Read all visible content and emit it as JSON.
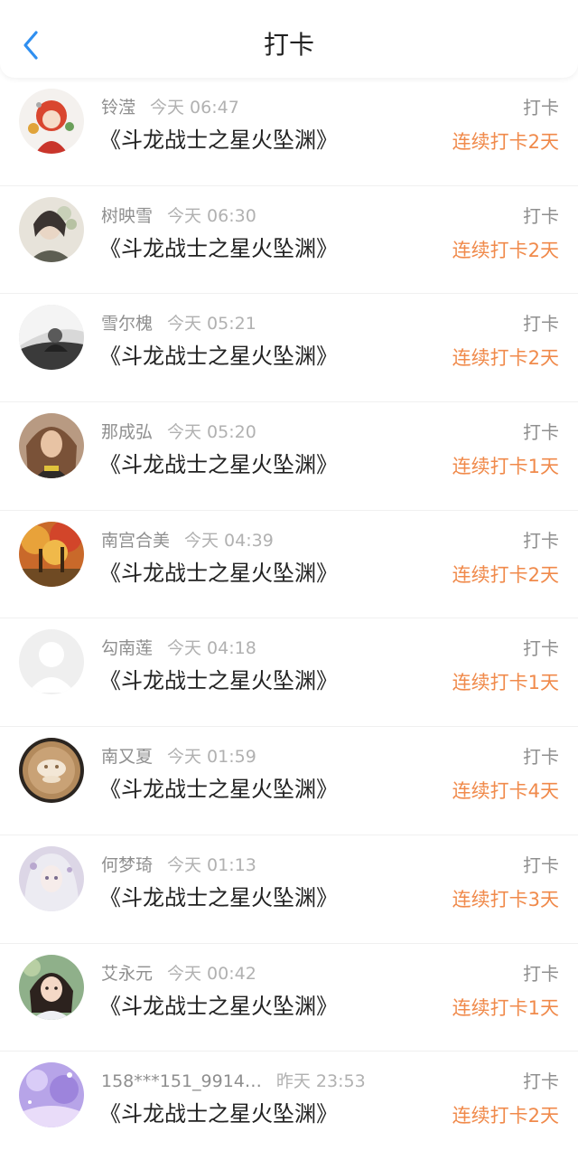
{
  "header": {
    "title": "打卡",
    "back_icon": "chevron-left-icon",
    "accent_color": "#2f8ff0"
  },
  "colors": {
    "streak": "#f08a4b",
    "name": "#8f8f8f",
    "title": "#222222"
  },
  "entries": [
    {
      "name": "铃滢",
      "time": "今天 06:47",
      "book": "《斗龙战士之星火坠渊》",
      "action": "打卡",
      "streak": "连续打卡2天",
      "avatar": "anime-girl-avatar"
    },
    {
      "name": "树映雪",
      "time": "今天 06:30",
      "book": "《斗龙战士之星火坠渊》",
      "action": "打卡",
      "streak": "连续打卡2天",
      "avatar": "woman-flowers-avatar"
    },
    {
      "name": "雪尔槐",
      "time": "今天 05:21",
      "book": "《斗龙战士之星火坠渊》",
      "action": "打卡",
      "streak": "连续打卡2天",
      "avatar": "black-white-photo-avatar"
    },
    {
      "name": "那成弘",
      "time": "今天 05:20",
      "book": "《斗龙战士之星火坠渊》",
      "action": "打卡",
      "streak": "连续打卡1天",
      "avatar": "woman-portrait-avatar"
    },
    {
      "name": "南宫合美",
      "time": "今天 04:39",
      "book": "《斗龙战士之星火坠渊》",
      "action": "打卡",
      "streak": "连续打卡2天",
      "avatar": "autumn-trees-avatar"
    },
    {
      "name": "勾南莲",
      "time": "今天 04:18",
      "book": "《斗龙战士之星火坠渊》",
      "action": "打卡",
      "streak": "连续打卡1天",
      "avatar": "default-user-avatar"
    },
    {
      "name": "南又夏",
      "time": "今天 01:59",
      "book": "《斗龙战士之星火坠渊》",
      "action": "打卡",
      "streak": "连续打卡4天",
      "avatar": "latte-art-avatar"
    },
    {
      "name": "何梦琦",
      "time": "今天 01:13",
      "book": "《斗龙战士之星火坠渊》",
      "action": "打卡",
      "streak": "连续打卡3天",
      "avatar": "anime-white-hair-avatar"
    },
    {
      "name": "艾永元",
      "time": "今天 00:42",
      "book": "《斗龙战士之星火坠渊》",
      "action": "打卡",
      "streak": "连续打卡1天",
      "avatar": "illustrated-girl-avatar"
    },
    {
      "name": "158***151_9914…",
      "time": "昨天 23:53",
      "book": "《斗龙战士之星火坠渊》",
      "action": "打卡",
      "streak": "连续打卡2天",
      "avatar": "purple-fantasy-avatar"
    }
  ]
}
